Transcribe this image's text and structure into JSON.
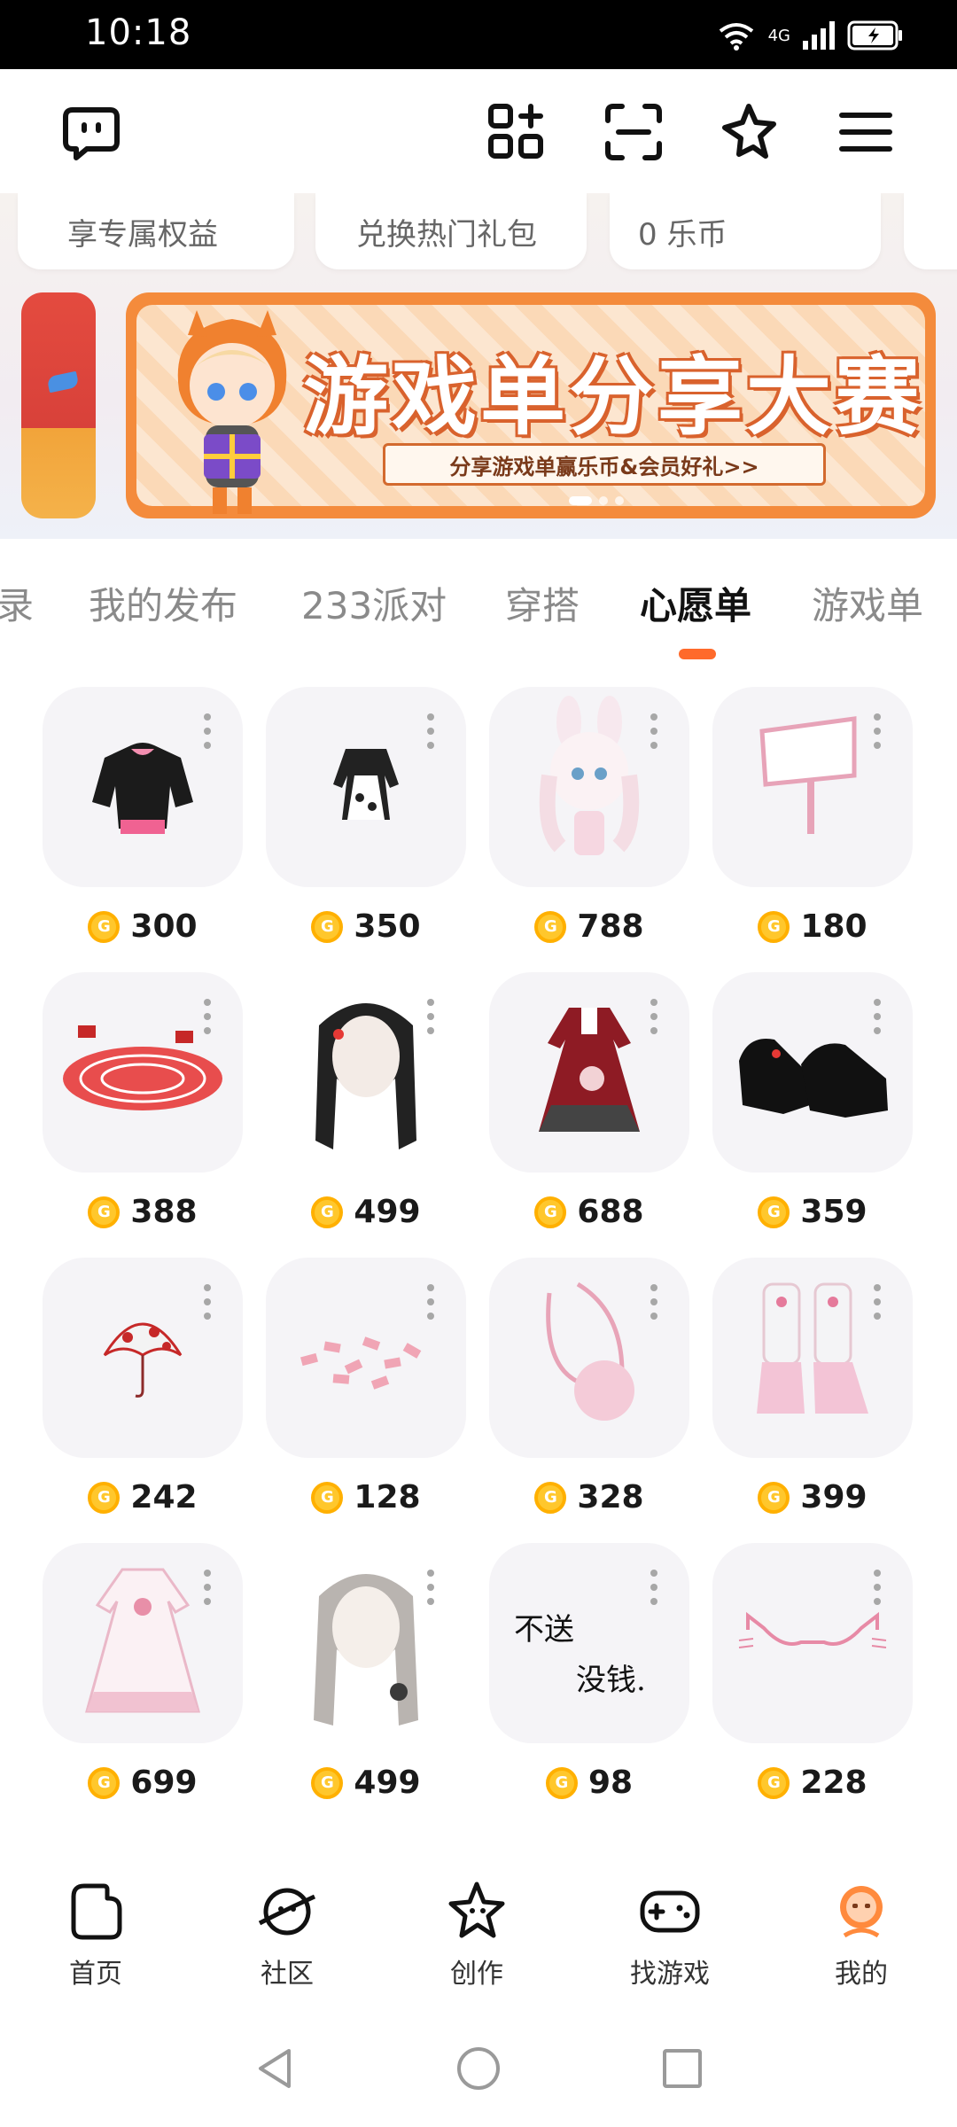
{
  "status_bar": {
    "time": "10:18",
    "network": "4G"
  },
  "header": {
    "icons": [
      "chat-bubble-icon",
      "add-app-icon",
      "scan-icon",
      "star-icon",
      "menu-icon"
    ]
  },
  "benefits": [
    {
      "label": "享专属权益"
    },
    {
      "label": "兑换热门礼包"
    },
    {
      "label": "0 乐币"
    }
  ],
  "banner": {
    "title": "游戏单分享大赛",
    "subtitle": "分享游戏单赢乐币&会员好礼>>"
  },
  "tabs": [
    {
      "label": "录"
    },
    {
      "label": "我的发布"
    },
    {
      "label": "233派对"
    },
    {
      "label": "穿搭"
    },
    {
      "label": "心愿单",
      "active": true
    },
    {
      "label": "游戏单"
    }
  ],
  "wishlist": {
    "items": [
      {
        "name": "black-pink-jacket",
        "price": "300"
      },
      {
        "name": "maid-outfit",
        "price": "350"
      },
      {
        "name": "bunny-character",
        "price": "788"
      },
      {
        "name": "pink-sign",
        "price": "180"
      },
      {
        "name": "red-magic-circle",
        "price": "388"
      },
      {
        "name": "black-long-hair",
        "price": "499"
      },
      {
        "name": "red-lolita-dress",
        "price": "688"
      },
      {
        "name": "black-platform-shoes",
        "price": "359"
      },
      {
        "name": "red-umbrella",
        "price": "242"
      },
      {
        "name": "pink-scatter",
        "price": "128"
      },
      {
        "name": "pink-round-bag",
        "price": "328"
      },
      {
        "name": "pink-boots",
        "price": "399"
      },
      {
        "name": "pink-white-dress",
        "price": "699"
      },
      {
        "name": "silver-long-hair",
        "price": "499"
      },
      {
        "name": "text-sticker",
        "price": "98",
        "sticker_text": [
          "不送",
          "没钱."
        ]
      },
      {
        "name": "cat-glasses",
        "price": "228"
      }
    ]
  },
  "bottom_nav": [
    {
      "label": "首页"
    },
    {
      "label": "社区"
    },
    {
      "label": "创作"
    },
    {
      "label": "找游戏"
    },
    {
      "label": "我的",
      "active": true
    }
  ],
  "colors": {
    "accent": "#ff6a2b",
    "coin": "#ffc72c",
    "banner": "#f48b3c"
  }
}
